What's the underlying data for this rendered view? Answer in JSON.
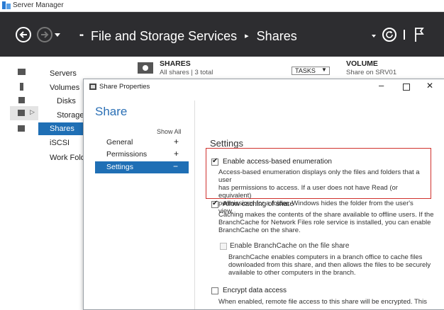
{
  "window": {
    "title": "Server Manager"
  },
  "header": {
    "breadcrumb": "File and Storage Services",
    "breadcrumb_child": "Shares",
    "prefix_arrows": "••"
  },
  "sidebar": {
    "items": [
      "Servers",
      "Volumes",
      "Disks",
      "Storage",
      "Shares",
      "iSCSI",
      "Work Fold"
    ]
  },
  "content": {
    "shares_title": "SHARES",
    "shares_sub": "All shares | 3 total",
    "tasks_label": "TASKS",
    "volume_title": "VOLUME",
    "volume_sub": "Share on SRV01"
  },
  "dialog": {
    "title": "Share Properties",
    "heading": "Share",
    "show_all": "Show All",
    "nav": [
      {
        "label": "General",
        "sign": "+"
      },
      {
        "label": "Permissions",
        "sign": "+"
      },
      {
        "label": "Settings",
        "sign": "−"
      }
    ],
    "settings_heading": "Settings",
    "abe": {
      "label": "Enable access-based enumeration",
      "checked": true,
      "desc": [
        "Access-based enumeration displays only the files and folders that a user",
        "has permissions to access. If a user does not have Read (or equivalent)",
        "permissions for a folder, Windows hides the folder from the user's view."
      ]
    },
    "caching": {
      "label": "Allow caching of share",
      "checked": true,
      "desc": [
        "Caching makes the contents of the share available to offline users. If the",
        "BranchCache for Network Files role service is installed, you can enable",
        "BranchCache on the share."
      ]
    },
    "branchcache": {
      "label": "Enable BranchCache on the file share",
      "checked": false,
      "desc": [
        "BranchCache enables computers in a branch office to cache files",
        "downloaded from this share, and then allows the files to be securely",
        "available to other computers in the branch."
      ]
    },
    "encrypt": {
      "label": "Encrypt data access",
      "checked": false,
      "desc": [
        "When enabled, remote file access to this share will be encrypted. This"
      ]
    }
  },
  "colors": {
    "header_bg": "#2d2d30",
    "selected_bg": "#1f6fb5",
    "highlight_border": "#d0312d"
  }
}
